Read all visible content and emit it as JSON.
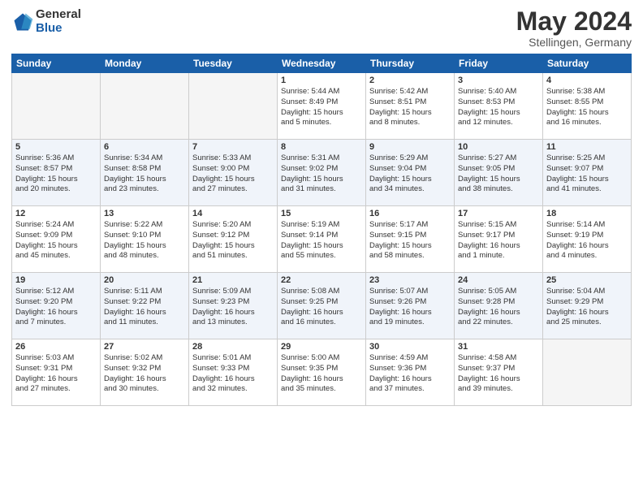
{
  "header": {
    "logo_general": "General",
    "logo_blue": "Blue",
    "month_year": "May 2024",
    "location": "Stellingen, Germany"
  },
  "weekdays": [
    "Sunday",
    "Monday",
    "Tuesday",
    "Wednesday",
    "Thursday",
    "Friday",
    "Saturday"
  ],
  "weeks": [
    [
      {
        "day": "",
        "info": ""
      },
      {
        "day": "",
        "info": ""
      },
      {
        "day": "",
        "info": ""
      },
      {
        "day": "1",
        "info": "Sunrise: 5:44 AM\nSunset: 8:49 PM\nDaylight: 15 hours\nand 5 minutes."
      },
      {
        "day": "2",
        "info": "Sunrise: 5:42 AM\nSunset: 8:51 PM\nDaylight: 15 hours\nand 8 minutes."
      },
      {
        "day": "3",
        "info": "Sunrise: 5:40 AM\nSunset: 8:53 PM\nDaylight: 15 hours\nand 12 minutes."
      },
      {
        "day": "4",
        "info": "Sunrise: 5:38 AM\nSunset: 8:55 PM\nDaylight: 15 hours\nand 16 minutes."
      }
    ],
    [
      {
        "day": "5",
        "info": "Sunrise: 5:36 AM\nSunset: 8:57 PM\nDaylight: 15 hours\nand 20 minutes."
      },
      {
        "day": "6",
        "info": "Sunrise: 5:34 AM\nSunset: 8:58 PM\nDaylight: 15 hours\nand 23 minutes."
      },
      {
        "day": "7",
        "info": "Sunrise: 5:33 AM\nSunset: 9:00 PM\nDaylight: 15 hours\nand 27 minutes."
      },
      {
        "day": "8",
        "info": "Sunrise: 5:31 AM\nSunset: 9:02 PM\nDaylight: 15 hours\nand 31 minutes."
      },
      {
        "day": "9",
        "info": "Sunrise: 5:29 AM\nSunset: 9:04 PM\nDaylight: 15 hours\nand 34 minutes."
      },
      {
        "day": "10",
        "info": "Sunrise: 5:27 AM\nSunset: 9:05 PM\nDaylight: 15 hours\nand 38 minutes."
      },
      {
        "day": "11",
        "info": "Sunrise: 5:25 AM\nSunset: 9:07 PM\nDaylight: 15 hours\nand 41 minutes."
      }
    ],
    [
      {
        "day": "12",
        "info": "Sunrise: 5:24 AM\nSunset: 9:09 PM\nDaylight: 15 hours\nand 45 minutes."
      },
      {
        "day": "13",
        "info": "Sunrise: 5:22 AM\nSunset: 9:10 PM\nDaylight: 15 hours\nand 48 minutes."
      },
      {
        "day": "14",
        "info": "Sunrise: 5:20 AM\nSunset: 9:12 PM\nDaylight: 15 hours\nand 51 minutes."
      },
      {
        "day": "15",
        "info": "Sunrise: 5:19 AM\nSunset: 9:14 PM\nDaylight: 15 hours\nand 55 minutes."
      },
      {
        "day": "16",
        "info": "Sunrise: 5:17 AM\nSunset: 9:15 PM\nDaylight: 15 hours\nand 58 minutes."
      },
      {
        "day": "17",
        "info": "Sunrise: 5:15 AM\nSunset: 9:17 PM\nDaylight: 16 hours\nand 1 minute."
      },
      {
        "day": "18",
        "info": "Sunrise: 5:14 AM\nSunset: 9:19 PM\nDaylight: 16 hours\nand 4 minutes."
      }
    ],
    [
      {
        "day": "19",
        "info": "Sunrise: 5:12 AM\nSunset: 9:20 PM\nDaylight: 16 hours\nand 7 minutes."
      },
      {
        "day": "20",
        "info": "Sunrise: 5:11 AM\nSunset: 9:22 PM\nDaylight: 16 hours\nand 11 minutes."
      },
      {
        "day": "21",
        "info": "Sunrise: 5:09 AM\nSunset: 9:23 PM\nDaylight: 16 hours\nand 13 minutes."
      },
      {
        "day": "22",
        "info": "Sunrise: 5:08 AM\nSunset: 9:25 PM\nDaylight: 16 hours\nand 16 minutes."
      },
      {
        "day": "23",
        "info": "Sunrise: 5:07 AM\nSunset: 9:26 PM\nDaylight: 16 hours\nand 19 minutes."
      },
      {
        "day": "24",
        "info": "Sunrise: 5:05 AM\nSunset: 9:28 PM\nDaylight: 16 hours\nand 22 minutes."
      },
      {
        "day": "25",
        "info": "Sunrise: 5:04 AM\nSunset: 9:29 PM\nDaylight: 16 hours\nand 25 minutes."
      }
    ],
    [
      {
        "day": "26",
        "info": "Sunrise: 5:03 AM\nSunset: 9:31 PM\nDaylight: 16 hours\nand 27 minutes."
      },
      {
        "day": "27",
        "info": "Sunrise: 5:02 AM\nSunset: 9:32 PM\nDaylight: 16 hours\nand 30 minutes."
      },
      {
        "day": "28",
        "info": "Sunrise: 5:01 AM\nSunset: 9:33 PM\nDaylight: 16 hours\nand 32 minutes."
      },
      {
        "day": "29",
        "info": "Sunrise: 5:00 AM\nSunset: 9:35 PM\nDaylight: 16 hours\nand 35 minutes."
      },
      {
        "day": "30",
        "info": "Sunrise: 4:59 AM\nSunset: 9:36 PM\nDaylight: 16 hours\nand 37 minutes."
      },
      {
        "day": "31",
        "info": "Sunrise: 4:58 AM\nSunset: 9:37 PM\nDaylight: 16 hours\nand 39 minutes."
      },
      {
        "day": "",
        "info": ""
      }
    ]
  ]
}
